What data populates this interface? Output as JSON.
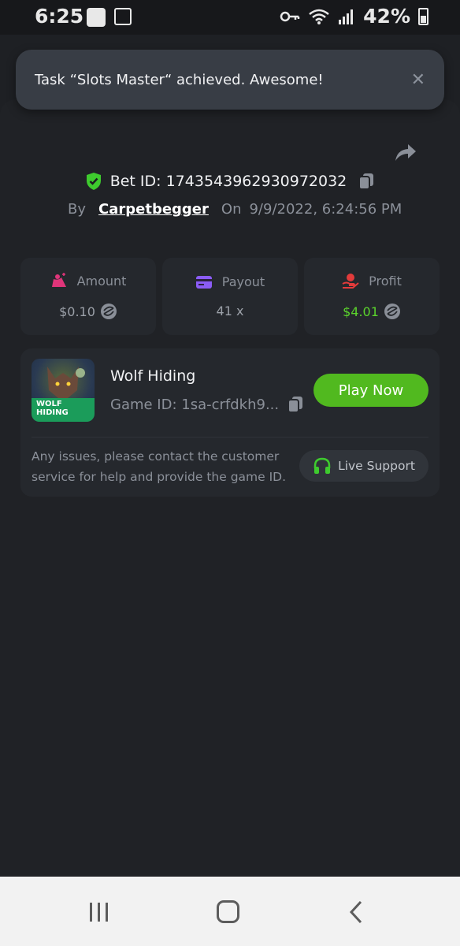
{
  "status_bar": {
    "time": "6:25",
    "battery": "42%"
  },
  "toast": {
    "message": "Task “Slots Master“ achieved. Awesome!",
    "close_glyph": "✕"
  },
  "bet": {
    "id_text": "Bet ID: 1743543962930972032",
    "by_label": "By",
    "user": "Carpetbegger",
    "on_label": "On",
    "date": "9/9/2022, 6:24:56 PM"
  },
  "stats": {
    "amount_label": "Amount",
    "amount_value": "$0.10",
    "payout_label": "Payout",
    "payout_value": "41 x",
    "profit_label": "Profit",
    "profit_value": "$4.01"
  },
  "game": {
    "title": "Wolf Hiding",
    "game_id": "Game ID: 1sa-crfdkh9...",
    "thumb_text_line1": "WOLF",
    "thumb_text_line2": "HIDING",
    "play_label": "Play Now",
    "issue_text": "Any issues, please contact the customer service for help and provide the game ID.",
    "support_label": "Live Support"
  },
  "colors": {
    "accent_green": "#51b91f",
    "profit_green": "#5bd32c",
    "amount_pink": "#e0357a",
    "payout_purple": "#8b5cf6",
    "profit_red": "#e23b3b"
  }
}
